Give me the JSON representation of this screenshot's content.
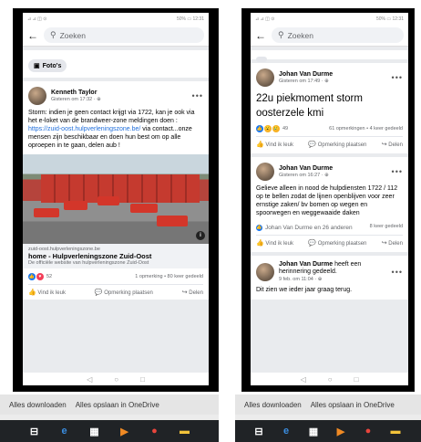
{
  "left": {
    "status": {
      "left": "⊿ ⊿ ◫ ⊙",
      "right": "50% ▭ 12:31"
    },
    "search_placeholder": "Zoeken",
    "photos_chip": "Foto's",
    "post": {
      "author": "Kenneth Taylor",
      "time": "Gisteren om 17:32 · ⊕",
      "text_before_link": "Storm: indien je geen contact krijgt via 1722, kan je ook via het e-loket van de brandweer-zone meldingen doen :",
      "link": "https://zuid-oost.hulpverleningszone.be/",
      "text_after_link": " via contact...onze mensen zijn beschikbaar en doen hun best om op alle oproepen in te gaan, delen aub !",
      "link_domain": "zuid-oost.hulpverleningszone.be",
      "link_title": "home - Hulpverleningszone Zuid-Oost",
      "link_desc": "De officiële website van hulpverleningszone Zuid-Oost",
      "reaction_count": "52",
      "stats": "1 opmerking • 80 keer gedeeld",
      "like": "Vind ik leuk",
      "comment": "Opmerking plaatsen",
      "share": "Delen"
    }
  },
  "right": {
    "status": {
      "left": "⊿ ⊿ ◫ ⊙",
      "right": "50% ▭ 12:31"
    },
    "search_placeholder": "Zoeken",
    "posts": [
      {
        "author": "Johan Van Durme",
        "time": "Gisteren om 17:49 · ⊕",
        "text": "22u piekmoment storm oosterzele kmi",
        "reaction_count": "49",
        "stats": "61 opmerkingen • 4 keer gedeeld",
        "like": "Vind ik leuk",
        "comment": "Opmerking plaatsen",
        "share": "Delen"
      },
      {
        "author": "Johan Van Durme",
        "time": "Gisteren om 16:27 · ⊕",
        "text": "Gelieve alleen in nood de hulpdiensten 1722 / 112 op te bellen zodat de lijnen openblijven voor zeer ernstige zaken/ bv bomen op wegen en spoorwegen en weggewaaide daken",
        "tagline": "Johan Van Durme en 26 anderen",
        "stats": "8 keer gedeeld",
        "like": "Vind ik leuk",
        "comment": "Opmerking plaatsen",
        "share": "Delen"
      },
      {
        "author": "Johan Van Durme",
        "author_suffix": " heeft een herinnering gedeeld.",
        "time": "9 feb. om 11:04 · ⊕",
        "text": "Dit zien we ieder jaar graag terug."
      }
    ]
  },
  "downloads": {
    "download_all": "Alles downloaden",
    "save_onedrive": "Alles opslaan in OneDrive"
  },
  "colors": {
    "facebook_blue": "#1877f2",
    "link": "#216fdb",
    "taskbar": "#202326"
  }
}
